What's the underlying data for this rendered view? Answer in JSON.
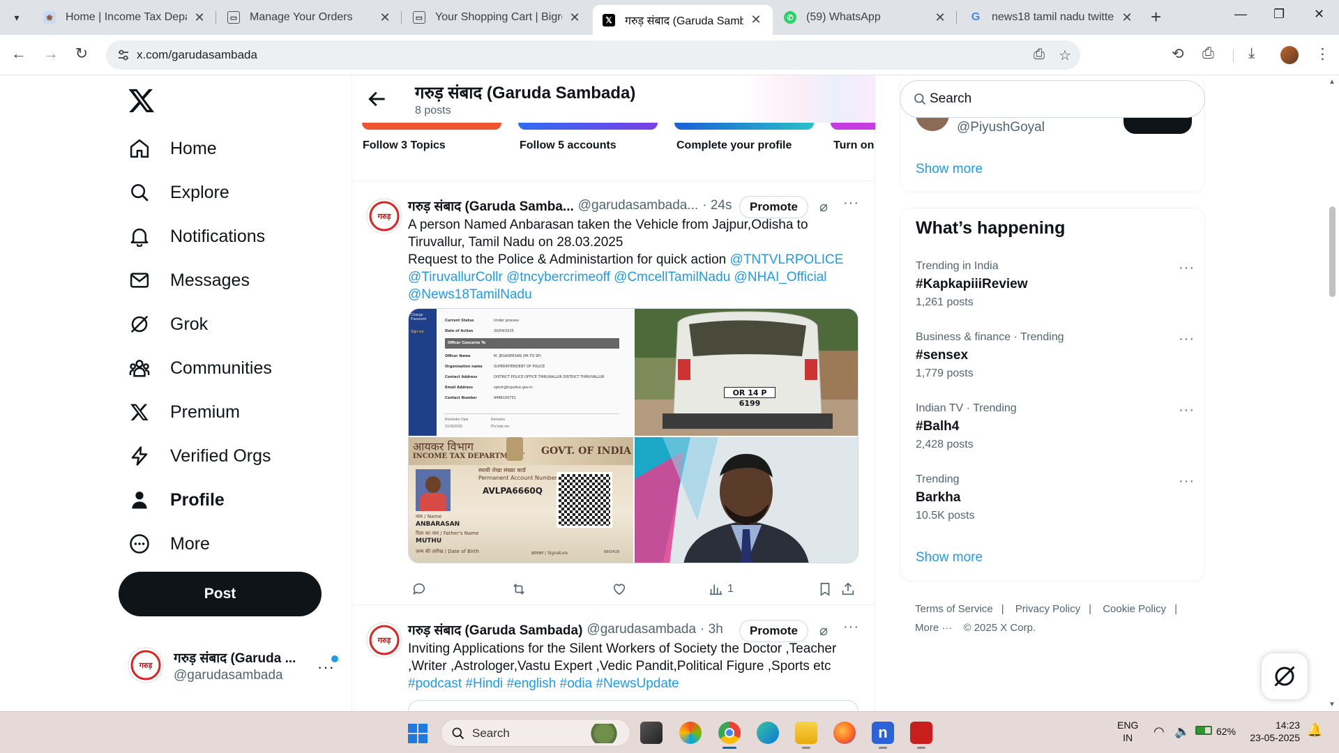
{
  "browser": {
    "tabs": [
      {
        "title": "Home | Income Tax Depart",
        "active": false
      },
      {
        "title": "Manage Your Orders",
        "active": false
      },
      {
        "title": "Your Shopping Cart | Bigro",
        "active": false
      },
      {
        "title": "गरुड़ संबाद (Garuda Samba",
        "active": true
      },
      {
        "title": "(59) WhatsApp",
        "active": false
      },
      {
        "title": "news18 tamil nadu twitter",
        "active": false
      }
    ],
    "url": "x.com/garudasambada"
  },
  "nav": {
    "items": [
      {
        "label": "Home",
        "icon": "home-icon"
      },
      {
        "label": "Explore",
        "icon": "search-icon"
      },
      {
        "label": "Notifications",
        "icon": "bell-icon"
      },
      {
        "label": "Messages",
        "icon": "envelope-icon"
      },
      {
        "label": "Grok",
        "icon": "grok-icon"
      },
      {
        "label": "Communities",
        "icon": "people-icon"
      },
      {
        "label": "Premium",
        "icon": "x-logo-icon"
      },
      {
        "label": "Verified Orgs",
        "icon": "lightning-icon"
      },
      {
        "label": "Profile",
        "icon": "person-icon"
      },
      {
        "label": "More",
        "icon": "more-circle-icon"
      }
    ],
    "post_label": "Post",
    "account": {
      "name": "गरुड़ संबाद (Garuda ...",
      "handle": "@garudasambada"
    }
  },
  "profile_header": {
    "title": "गरुड़ संबाद (Garuda Sambada)",
    "posts": "8 posts"
  },
  "onboarding": [
    "Follow 3 Topics",
    "Follow 5 accounts",
    "Complete your profile",
    "Turn on"
  ],
  "tweets": [
    {
      "name": "गरुड़ संबाद (Garuda Samba...",
      "handle": "@garudasambada...",
      "time": "· 24s",
      "promote": "Promote",
      "line1": "A person Named Anbarasan taken the Vehicle from Jajpur,Odisha to Tiruvallur, Tamil Nadu on 28.03.2025",
      "line2": "Request to the Police & Administartion for quick action ",
      "mentions": [
        "@TNTVLRPOLICE",
        "@TiruvallurCollr",
        "@tncybercrimeoff",
        "@CmcellTamilNadu",
        "@NHAI_Official",
        "@News18TamilNadu"
      ],
      "views": "1",
      "media": {
        "doc": {
          "rows": [
            [
              "Current Status",
              "Under process"
            ],
            [
              "Date of Action",
              "20/04/2025"
            ],
            [
              "Officer Concerns To",
              ""
            ],
            [
              "Officer Name",
              "M. JEGADEESAN (PA TO SP)"
            ],
            [
              "Organisation name",
              "SUPERINTENDENT OF POLICE"
            ],
            [
              "Contact Address",
              "DISTRICT POLICE OFFICE THIRUVALLUR DISTRICT THIRUVALLUR"
            ],
            [
              "Email Address",
              "sptvlr@tnpolice.gov.in"
            ],
            [
              "Contact Number",
              "9498100751"
            ]
          ],
          "footer": [
            "Reminder Date",
            "Remarks",
            "01/05/2025",
            "Pls help me"
          ],
          "side": [
            "Change Password",
            "Sign out"
          ]
        },
        "plate": "OR 14 P 6199",
        "pan": {
          "dept_hi": "आयकर विभाग",
          "dept_en": "INCOME TAX DEPARTMENT",
          "govt": "GOVT. OF INDIA",
          "card_hi": "स्थायी लेखा संख्या कार्ड",
          "card_en": "Permanent Account Number Card",
          "number": "AVLPA6660Q",
          "name_label": "नाम / Name",
          "name": "ANBARASAN",
          "father_label": "पिता का नाम / Father's Name",
          "father": "MUTHU",
          "dob_label": "जन्म की तारीख / Date of Birth",
          "sign_label": "हस्ताक्षर / Signature",
          "code": "6803428"
        }
      }
    },
    {
      "name": "गरुड़ संबाद (Garuda Sambada)",
      "handle": "@garudasambada",
      "time": "· 3h",
      "promote": "Promote",
      "text": "Inviting Applications for the Silent Workers of Society the Doctor ,Teacher ,Writer ,Astrologer,Vastu Expert ,Vedic Pandit,Political Figure ,Sports etc",
      "hashtags": [
        "#podcast",
        "#Hindi",
        "#english",
        "#odia",
        "#NewsUpdate"
      ]
    }
  ],
  "sidebar": {
    "search_placeholder": "Search",
    "suggest_handle": "@PiyushGoyal",
    "show_more": "Show more",
    "happening_title": "What’s happening",
    "trends": [
      {
        "context": "Trending in India",
        "tag": "#KapkapiiiReview",
        "count": "1,261 posts"
      },
      {
        "context": "Business & finance · Trending",
        "tag": "#sensex",
        "count": "1,779 posts"
      },
      {
        "context": "Indian TV · Trending",
        "tag": "#Balh4",
        "count": "2,428 posts"
      },
      {
        "context": "Trending",
        "tag": "Barkha",
        "count": "10.5K posts"
      }
    ],
    "footer": [
      "Terms of Service",
      "|",
      "Privacy Policy",
      "|",
      "Cookie Policy",
      "|",
      "More ···",
      "© 2025 X Corp."
    ]
  },
  "taskbar": {
    "search": "Search",
    "lang1": "ENG",
    "lang2": "IN",
    "battery": "62%",
    "time": "14:23",
    "date": "23-05-2025"
  },
  "colors": {
    "accent": "#1d9bf0",
    "text": "#0f1419",
    "muted": "#536471"
  }
}
